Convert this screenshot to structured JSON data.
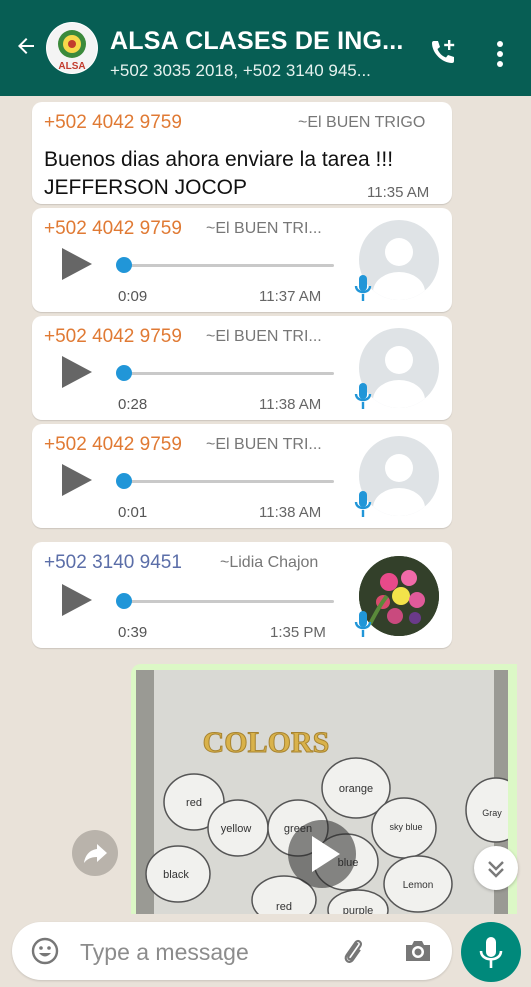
{
  "header": {
    "title": "ALSA  CLASES DE ING...",
    "subtitle": "+502 3035 2018, +502 3140 945...",
    "avatar_logo_text": "ALSA",
    "color": "#075e54"
  },
  "messages": [
    {
      "type": "text",
      "sender": "+502 4042 9759",
      "alias": "~El BUEN TRIGO",
      "text": "Buenos dias ahora enviare la tarea !!!\nJEFFERSON JOCOP",
      "time": "11:35 AM"
    },
    {
      "type": "voice",
      "sender": "+502 4042 9759",
      "alias": "~El BUEN TRI...",
      "duration": "0:09",
      "time": "11:37 AM",
      "progress": 0
    },
    {
      "type": "voice",
      "sender": "+502 4042 9759",
      "alias": "~El BUEN TRI...",
      "duration": "0:28",
      "time": "11:38 AM",
      "progress": 0
    },
    {
      "type": "voice",
      "sender": "+502 4042 9759",
      "alias": "~El BUEN TRI...",
      "duration": "0:01",
      "time": "11:38 AM",
      "progress": 0
    },
    {
      "type": "voice",
      "sender": "+502 3140 9451",
      "alias": "~Lidia Chajon",
      "duration": "0:39",
      "time": "1:35 PM",
      "progress": 0
    }
  ],
  "video_message": {
    "photo_title": "COLORS",
    "balloon_words": [
      "red",
      "yellow",
      "green",
      "orange",
      "sky blue",
      "Gray",
      "black",
      "blue",
      "Lemon",
      "red",
      "purple"
    ]
  },
  "composer": {
    "placeholder": "Type a message"
  },
  "icons": [
    "back-arrow-icon",
    "add-call-icon",
    "more-options-icon",
    "play-icon",
    "mic-icon",
    "emoji-icon",
    "attach-icon",
    "camera-icon",
    "forward-icon",
    "scroll-down-icon",
    "video-play-icon"
  ],
  "colors": {
    "sender_orange": "#e07a34",
    "sender_blue": "#5b6ea8",
    "voice_accent": "#2196d8",
    "outgoing_bubble": "#dcf8c6",
    "send_button": "#00897b"
  }
}
